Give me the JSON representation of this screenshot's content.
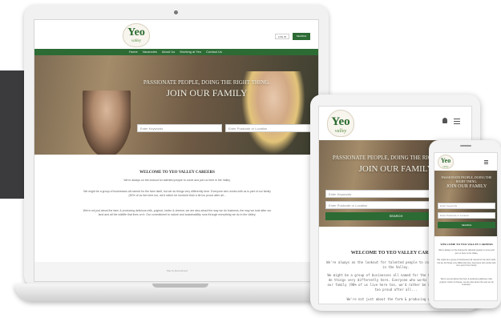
{
  "laptop_site": {
    "logo_main": "Yeo",
    "logo_sub": "valley",
    "nav": [
      "Home",
      "Vacancies",
      "About Us",
      "Working at Yeo",
      "Contact Us"
    ],
    "login_label": "LOG IN",
    "search_label": "SEARCH",
    "hero_line1": "PASSIONATE PEOPLE, DOING THE RIGHT THING.",
    "hero_line2": "JOIN OUR FAMILY",
    "keywords_placeholder": "Enter Keywords",
    "location_placeholder": "Enter Postcode or Location",
    "welcome_title": "WELCOME TO YEO VALLEY CAREERS",
    "welcome_p1": "We're always on the lookout for talented people to come and join us here in the Valley.",
    "welcome_p2": "We might be a group of businesses all named for the farm itself, but we do things very differently here. Everyone who works with us is part of our family (90% of us live here too, we'd rather be involved than a bit too proud after all...",
    "welcome_p3": "We're not just about the farm & producing delicious milk, yoghurt, butter & cheese; we are also about the way we do business, the way we look after our land and all the wildlife that lives on it. Our commitment to nature and sustainability runs through everything we do in the Valley.",
    "footer_text": "Site by Recruitment"
  },
  "tablet_site": {
    "logo_main": "Yeo",
    "logo_sub": "valley",
    "hero_line1": "PASSIONATE PEOPLE, DOING THE RIGHT THING.",
    "hero_line2": "JOIN OUR FAMILY",
    "keywords_placeholder": "Enter Keywords",
    "location_placeholder": "Enter Postcode or Location",
    "search_label": "SEARCH",
    "welcome_title": "WELCOME TO YEO VALLEY CAREERS",
    "welcome_p1": "We're always on the lookout for talented people to come and join us here in the Valley.",
    "welcome_p2": "We might be a group of businesses all named for the farm itself, but we do things very differently here. Everyone who works with us is part of our family (90% of us live here too, we'd rather be involved than a bit too proud after all...",
    "welcome_p3": "We're not just about the farm & producing delicious"
  },
  "phone_site": {
    "logo_main": "Yeo",
    "logo_sub": "valley",
    "hero_line1": "PASSIONATE PEOPLE, DOING THE RIGHT THING.",
    "hero_line2": "JOIN OUR FAMILY",
    "keywords_placeholder": "Enter Keywords",
    "location_placeholder": "Enter Postcode or Location",
    "search_label": "SEARCH",
    "welcome_title": "WELCOME TO YEO VALLEY CAREERS",
    "welcome_p1": "We're always on the lookout for talented people to come and join us here in the Valley.",
    "welcome_p2": "We might be a group of businesses all named for the farm itself, but we do things very differently here. Everyone who works with us is part of our family.",
    "welcome_p3": "We're not just about the farm & producing delicious milk, yoghurt, butter & cheese; we are also about the way we do business."
  },
  "colors": {
    "brand_green": "#2d6b35",
    "dark_panel": "#3b3b3e"
  }
}
